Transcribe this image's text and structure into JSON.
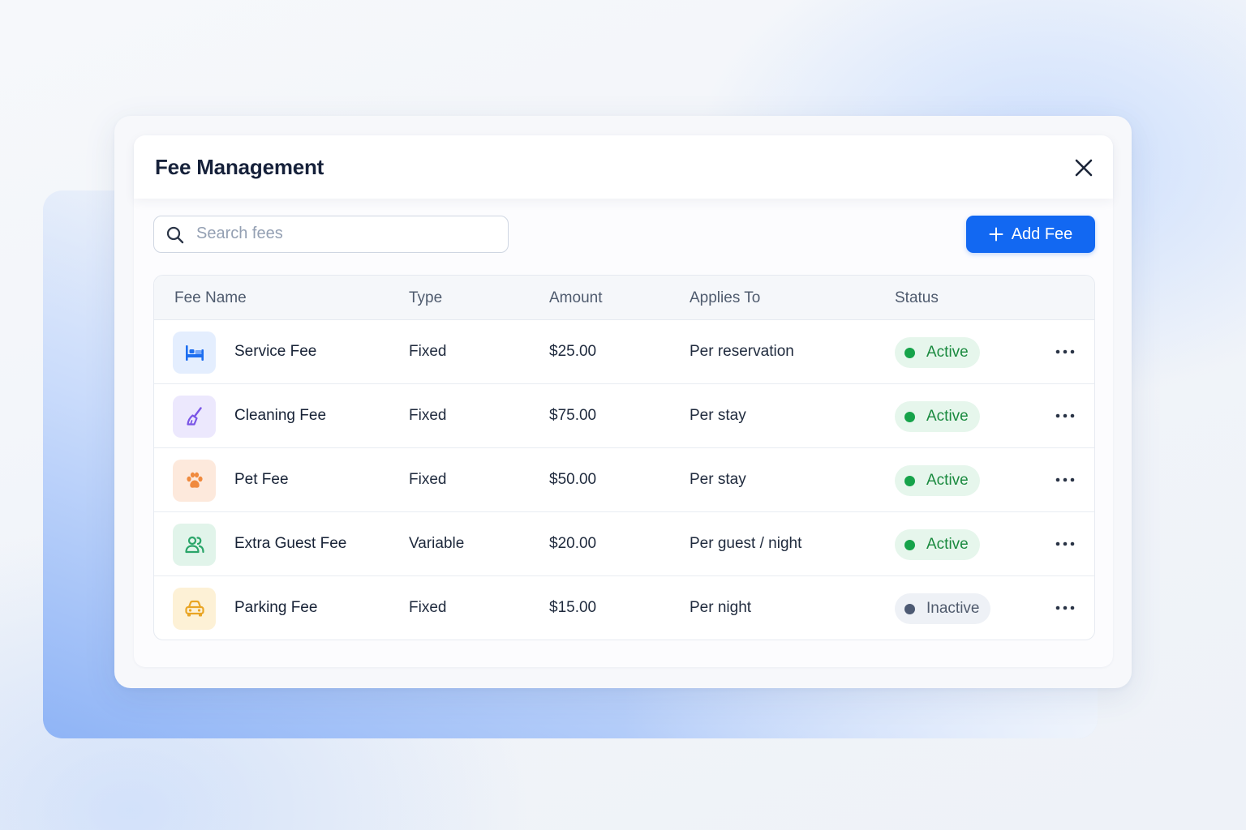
{
  "modal": {
    "title": "Fee Management",
    "close_icon": "close-icon"
  },
  "toolbar": {
    "search_placeholder": "Search fees",
    "search_value": "",
    "add_label": "Add Fee",
    "add_icon": "plus-icon",
    "accent": "#1268f2"
  },
  "table": {
    "headers": {
      "name": "Fee Name",
      "type": "Type",
      "amount": "Amount",
      "applies": "Applies To",
      "status": "Status"
    },
    "rows": [
      {
        "icon": "bed-icon",
        "icon_bg": "#e4eefe",
        "icon_color": "#1d6ef0",
        "name": "Service Fee",
        "type": "Fixed",
        "amount": "$25.00",
        "applies": "Per reservation",
        "status": "Active",
        "status_kind": "active"
      },
      {
        "icon": "broom-icon",
        "icon_bg": "#ece8fd",
        "icon_color": "#7a55e6",
        "name": "Cleaning Fee",
        "type": "Fixed",
        "amount": "$75.00",
        "applies": "Per stay",
        "status": "Active",
        "status_kind": "active"
      },
      {
        "icon": "paw-icon",
        "icon_bg": "#fde9dc",
        "icon_color": "#f08a3e",
        "name": "Pet Fee",
        "type": "Fixed",
        "amount": "$50.00",
        "applies": "Per stay",
        "status": "Active",
        "status_kind": "active"
      },
      {
        "icon": "users-icon",
        "icon_bg": "#e1f4ea",
        "icon_color": "#2aa569",
        "name": "Extra Guest Fee",
        "type": "Variable",
        "amount": "$20.00",
        "applies": "Per guest / night",
        "status": "Active",
        "status_kind": "active"
      },
      {
        "icon": "car-icon",
        "icon_bg": "#fdf1d6",
        "icon_color": "#e9a524",
        "name": "Parking Fee",
        "type": "Fixed",
        "amount": "$15.00",
        "applies": "Per night",
        "status": "Inactive",
        "status_kind": "inactive"
      }
    ],
    "row_action_icon": "more-horizontal-icon"
  },
  "colors": {
    "active_text": "#1a8a3f",
    "active_bg": "#e6f6ec",
    "inactive_text": "#505b6d",
    "inactive_bg": "#eef1f6"
  }
}
